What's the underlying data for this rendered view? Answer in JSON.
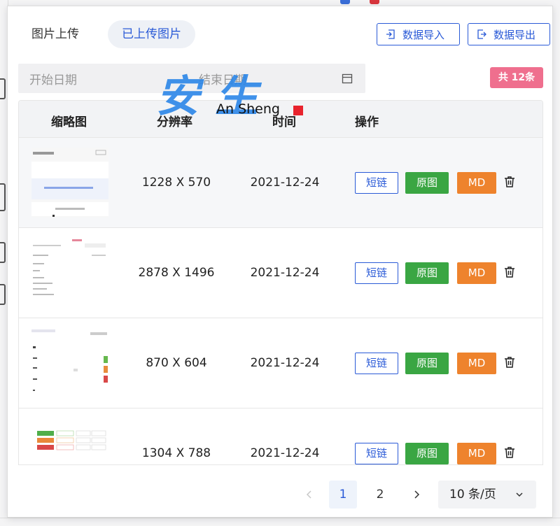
{
  "tabs": {
    "upload": "图片上传",
    "uploaded": "已上传图片"
  },
  "toolbar": {
    "import_label": "数据导入",
    "export_label": "数据导出"
  },
  "filter": {
    "start_placeholder": "开始日期",
    "end_placeholder": "结束日期",
    "total_badge": "共 12条"
  },
  "watermark": {
    "cn": "安生",
    "en": "An Sheng"
  },
  "table": {
    "headers": {
      "thumbnail": "缩略图",
      "resolution": "分辨率",
      "time": "时间",
      "actions": "操作"
    },
    "rows": [
      {
        "resolution": "1228 X 570",
        "time": "2021-12-24"
      },
      {
        "resolution": "2878 X 1496",
        "time": "2021-12-24"
      },
      {
        "resolution": "870 X 604",
        "time": "2021-12-24"
      },
      {
        "resolution": "1304 X 788",
        "time": "2021-12-24"
      }
    ],
    "actions": {
      "short_link": "短链",
      "original": "原图",
      "md": "MD"
    }
  },
  "pagination": {
    "page1": "1",
    "page2": "2",
    "page_size": "10 条/页"
  },
  "colors": {
    "primary": "#2a5ad7",
    "success": "#3aa643",
    "warning": "#ee832d",
    "badge": "#ef6f8e"
  }
}
